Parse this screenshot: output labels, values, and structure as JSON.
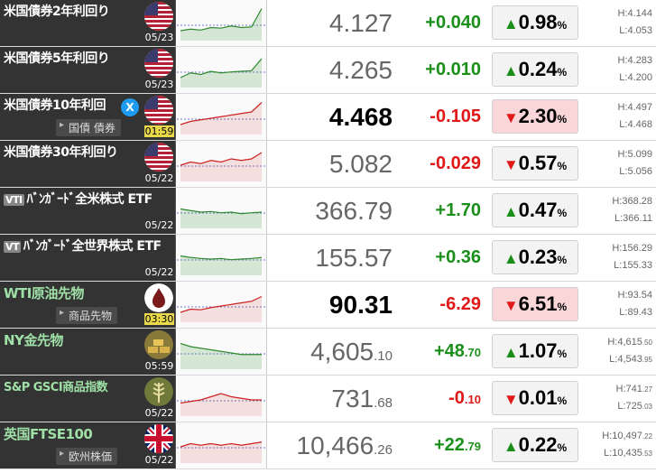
{
  "rows": [
    {
      "name": "米国債券2年利回り",
      "tag": "",
      "time": "05/23",
      "price": "4.127",
      "price_small": "",
      "change": "+0.040",
      "change_small": "",
      "dir": "up",
      "pct": "0.98",
      "high": "H:4.144",
      "high_small": "",
      "low": "L:4.053",
      "low_small": "",
      "icon": "us-flag-icon",
      "spark": "green-line",
      "chart_values": [
        0.2,
        0.25,
        0.22,
        0.3,
        0.28,
        0.35,
        0.3,
        0.32,
        0.9
      ]
    },
    {
      "name": "米国債券5年利回り",
      "tag": "",
      "time": "05/23",
      "price": "4.265",
      "price_small": "",
      "change": "+0.010",
      "change_small": "",
      "dir": "up",
      "pct": "0.24",
      "high": "H:4.283",
      "high_small": "",
      "low": "L:4.200",
      "low_small": "",
      "icon": "us-flag-icon",
      "spark": "green-line",
      "chart_values": [
        0.2,
        0.35,
        0.3,
        0.4,
        0.35,
        0.38,
        0.4,
        0.42,
        0.8
      ]
    },
    {
      "name": "米国債券10年利回",
      "tag": "国債 債券",
      "time": "01:59",
      "price": "4.468",
      "price_small": "",
      "change": "-0.105",
      "change_small": "",
      "dir": "down",
      "pct": "2.30",
      "high": "H:4.497",
      "high_small": "",
      "low": "L:4.468",
      "low_small": "",
      "icon": "us-flag-icon",
      "spark": "red-line",
      "chart_values": [
        0.2,
        0.3,
        0.35,
        0.4,
        0.45,
        0.5,
        0.55,
        0.6,
        0.9
      ]
    },
    {
      "name": "米国債券30年利回り",
      "tag": "",
      "time": "05/22",
      "price": "5.082",
      "price_small": "",
      "change": "-0.029",
      "change_small": "",
      "dir": "down",
      "pct": "0.57",
      "high": "H:5.099",
      "high_small": "",
      "low": "L:5.056",
      "low_small": "",
      "icon": "us-flag-icon",
      "spark": "red-line",
      "chart_values": [
        0.4,
        0.5,
        0.45,
        0.55,
        0.5,
        0.6,
        0.55,
        0.6,
        0.8
      ]
    },
    {
      "name": "ﾊﾞﾝｶﾞｰﾄﾞ全米株式 ETF",
      "etf": "VTI",
      "tag": "",
      "time": "05/22",
      "price": "366.79",
      "price_small": "",
      "change": "+1.70",
      "change_small": "",
      "dir": "up",
      "pct": "0.47",
      "high": "H:368.28",
      "high_small": "",
      "low": "L:366.11",
      "low_small": "",
      "icon": "",
      "spark": "green-line",
      "chart_values": [
        0.5,
        0.45,
        0.4,
        0.42,
        0.38,
        0.4,
        0.35,
        0.38,
        0.4
      ]
    },
    {
      "name": "ﾊﾞﾝｶﾞｰﾄﾞ全世界株式 ETF",
      "etf": "VT",
      "tag": "",
      "time": "05/22",
      "price": "155.57",
      "price_small": "",
      "change": "+0.36",
      "change_small": "",
      "dir": "up",
      "pct": "0.23",
      "high": "H:156.29",
      "high_small": "",
      "low": "L:155.33",
      "low_small": "",
      "icon": "",
      "spark": "green-line",
      "chart_values": [
        0.5,
        0.45,
        0.42,
        0.4,
        0.42,
        0.38,
        0.4,
        0.42,
        0.45
      ]
    },
    {
      "name": "WTI原油先物",
      "tag": "商品先物",
      "time": "03:30",
      "price": "90.31",
      "price_small": "",
      "change": "-6.29",
      "change_small": "",
      "dir": "down",
      "pct": "6.51",
      "high": "H:93.54",
      "high_small": "",
      "low": "L:89.43",
      "low_small": "",
      "icon": "oil-drop-icon",
      "spark": "red-line",
      "chart_values": [
        0.2,
        0.3,
        0.28,
        0.35,
        0.4,
        0.45,
        0.5,
        0.55,
        0.7
      ]
    },
    {
      "name": "NY金先物",
      "tag": "",
      "time": "05:59",
      "price": "4,605",
      "price_small": ".10",
      "change": "+48",
      "change_small": ".70",
      "dir": "up",
      "pct": "1.07",
      "high": "H:4,615",
      "high_small": ".50",
      "low": "L:4,543",
      "low_small": ".95",
      "icon": "gold-bars-icon",
      "spark": "green-line",
      "chart_values": [
        0.7,
        0.6,
        0.55,
        0.5,
        0.45,
        0.4,
        0.35,
        0.35,
        0.35
      ]
    },
    {
      "name": "S&P GSCI商品指数",
      "tag": "",
      "time": "05/22",
      "price": "731",
      "price_small": ".68",
      "change": "-0",
      "change_small": ".10",
      "dir": "down",
      "pct": "0.01",
      "high": "H:741",
      "high_small": ".27",
      "low": "L:725",
      "low_small": ".03",
      "icon": "wheat-icon",
      "spark": "red-line",
      "chart_values": [
        0.3,
        0.35,
        0.4,
        0.5,
        0.6,
        0.5,
        0.45,
        0.4,
        0.4
      ]
    },
    {
      "name": "英国FTSE100",
      "tag": "欧州株価",
      "time": "05/22",
      "price": "10,466",
      "price_small": ".26",
      "change": "+22",
      "change_small": ".79",
      "dir": "up",
      "pct": "0.22",
      "high": "H:10,497",
      "high_small": ".22",
      "low": "L:10,435",
      "low_small": ".53",
      "icon": "uk-flag-icon",
      "spark": "red-line",
      "chart_values": [
        0.4,
        0.5,
        0.45,
        0.5,
        0.45,
        0.5,
        0.45,
        0.5,
        0.55
      ]
    }
  ],
  "pct_unit": "%",
  "colors": {
    "up": "#1a8f1a",
    "down": "#e01818",
    "neg_bg": "#f9d6d8",
    "name_bg": "#333333"
  }
}
